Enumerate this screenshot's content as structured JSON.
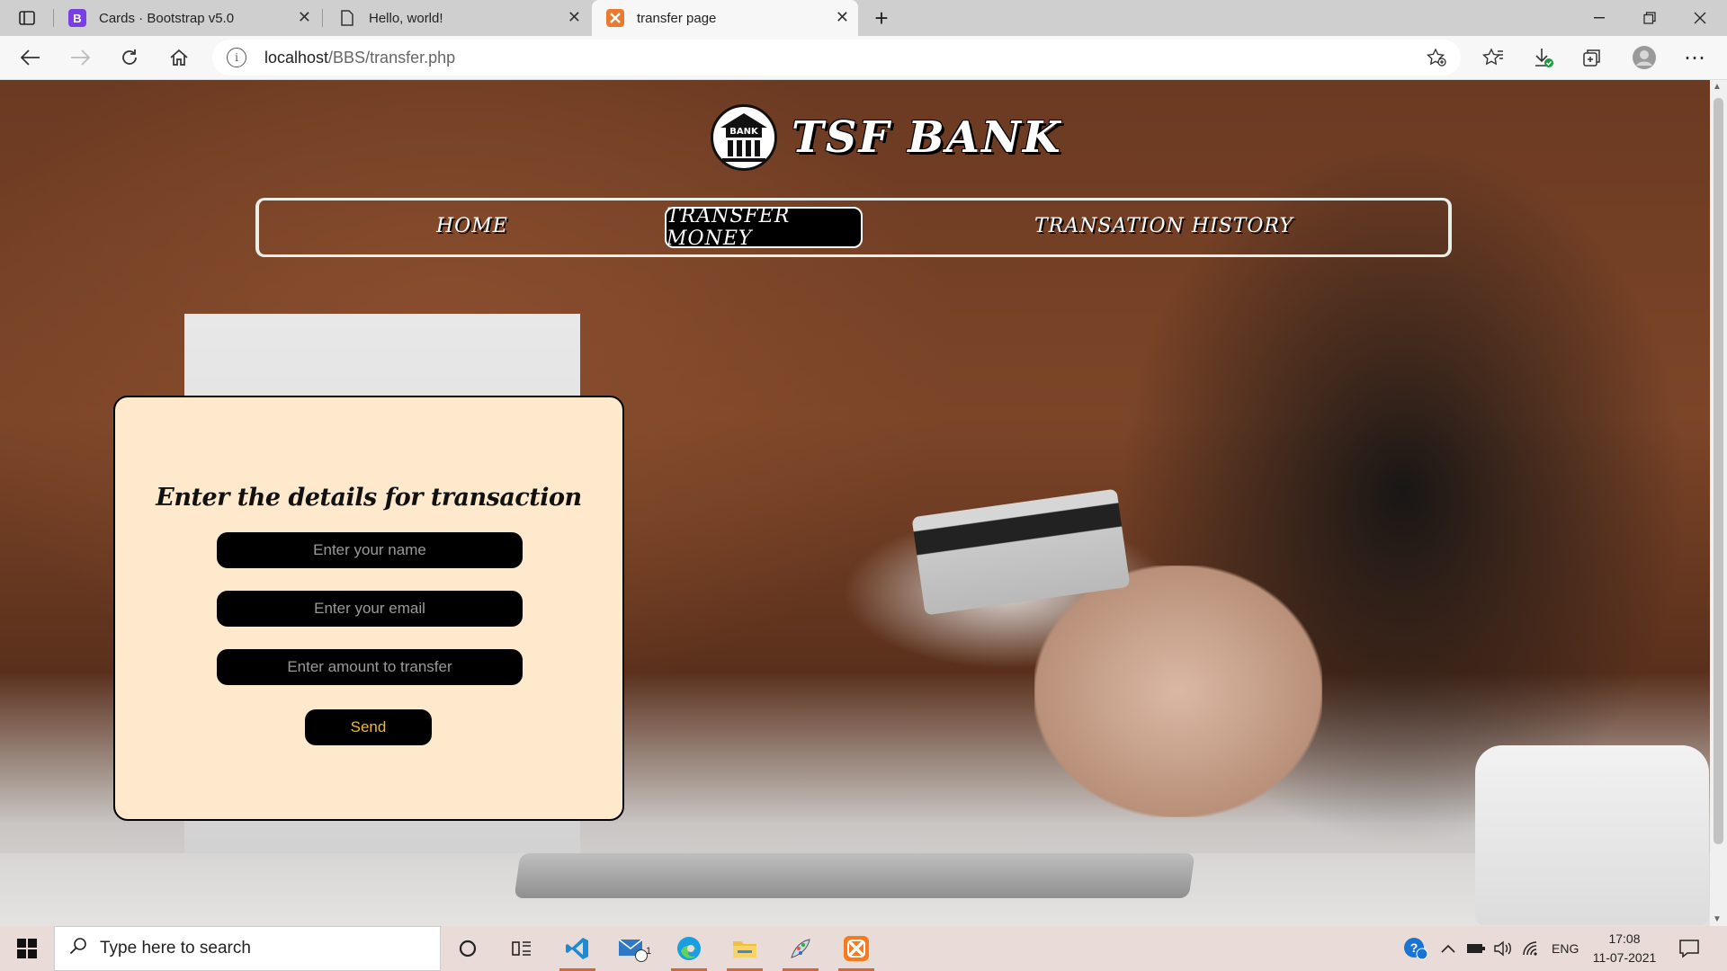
{
  "browser": {
    "tabs": [
      {
        "title": "Cards · Bootstrap v5.0",
        "icon": "bootstrap-icon",
        "active": false
      },
      {
        "title": "Hello, world!",
        "icon": "page-icon",
        "active": false
      },
      {
        "title": "transfer page",
        "icon": "xampp-icon",
        "active": true
      }
    ],
    "address": {
      "host": "localhost",
      "path": "/BBS/transfer.php"
    },
    "new_tab": "+"
  },
  "site": {
    "logo_badge_text": "BANK",
    "title": "TSF BANK",
    "nav": [
      {
        "label": "HOME",
        "active": false
      },
      {
        "label": "TRANSFER MONEY",
        "active": true
      },
      {
        "label": "TRANSATION HISTORY",
        "active": false
      }
    ]
  },
  "form": {
    "title": "Enter the details for transaction",
    "name_placeholder": "Enter your name",
    "email_placeholder": "Enter your email",
    "amount_placeholder": "Enter amount to transfer",
    "send_label": "Send",
    "send_color": "#f5b833",
    "card_bg": "#fee9cc"
  },
  "taskbar": {
    "search_placeholder": "Type here to search",
    "mail_badge": "1",
    "language": "ENG",
    "time": "17:08",
    "date": "11-07-2021"
  }
}
